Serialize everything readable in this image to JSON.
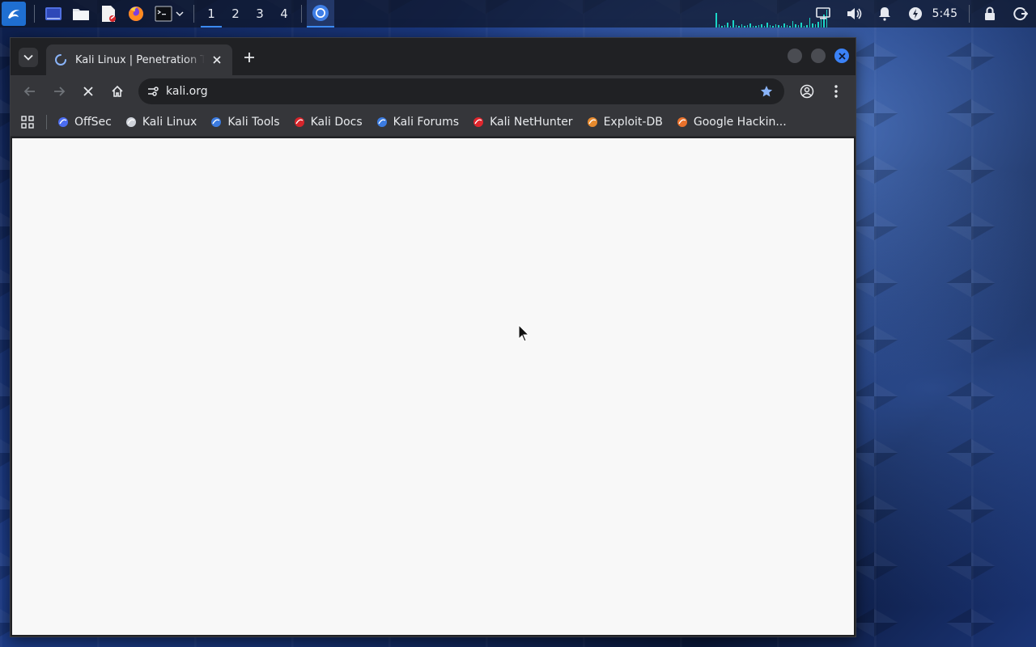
{
  "panel": {
    "workspaces": [
      "1",
      "2",
      "3",
      "4"
    ],
    "active_workspace": "1",
    "clock": "5:45",
    "launchers": [
      "kali-menu-icon",
      "desktop-icon",
      "file-manager-icon",
      "text-editor-icon",
      "firefox-icon",
      "terminal-icon"
    ]
  },
  "browser": {
    "tab": {
      "title": "Kali Linux | Penetration Testing and Ethical Hacking Linux Distribution",
      "loading": true
    },
    "address": "kali.org",
    "bookmarks": [
      {
        "label": "OffSec",
        "icon": "offsec-icon",
        "color": "#4b6cf0"
      },
      {
        "label": "Kali Linux",
        "icon": "kali-dragon-icon",
        "color": "#cfd3da"
      },
      {
        "label": "Kali Tools",
        "icon": "kali-tools-icon",
        "color": "#3b7be0"
      },
      {
        "label": "Kali Docs",
        "icon": "kali-docs-icon",
        "color": "#d6252b"
      },
      {
        "label": "Kali Forums",
        "icon": "kali-forums-icon",
        "color": "#3b7be0"
      },
      {
        "label": "Kali NetHunter",
        "icon": "nethunter-icon",
        "color": "#e0262d"
      },
      {
        "label": "Exploit-DB",
        "icon": "exploit-db-icon",
        "color": "#e68a2e"
      },
      {
        "label": "Google Hackin...",
        "icon": "ghdb-icon",
        "color": "#e8712b"
      }
    ]
  },
  "colors": {
    "accent": "#3d8df5",
    "browser_bg": "#202124",
    "toolbar": "#35363a",
    "page_bg": "#f8f8f8"
  }
}
